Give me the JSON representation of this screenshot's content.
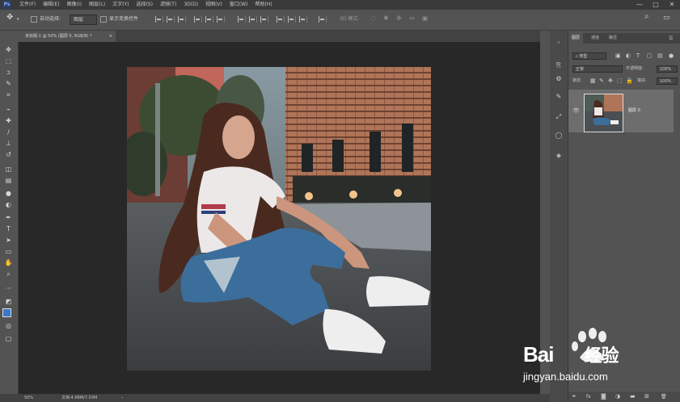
{
  "app": {
    "logo_text": "Ps",
    "menu": [
      "文件(F)",
      "编辑(E)",
      "图像(I)",
      "图层(L)",
      "文字(Y)",
      "选择(S)",
      "滤镜(T)",
      "3D(D)",
      "视图(V)",
      "窗口(W)",
      "帮助(H)"
    ],
    "window_controls": {
      "minimize": "—",
      "maximize": "□",
      "close": "✕"
    }
  },
  "options_bar": {
    "tool_icon": "move-icon",
    "auto_select_label": "自动选择:",
    "auto_select_value": "图层",
    "transform_controls_label": "显示变换控件",
    "mode_3d_label": "3D 模式:",
    "search_icon": "search-icon",
    "workspace_icon": "workspace-icon"
  },
  "document": {
    "tab_title": "未标题-1 @ 50% (图层 0, RGB/8) *",
    "tab_close": "×"
  },
  "status_bar": {
    "zoom": "50%",
    "doc_info": "文档:4.68M/7.03M",
    "arrow": "›"
  },
  "tools": [
    {
      "name": "move-tool",
      "glyph": "✥"
    },
    {
      "name": "marquee-tool",
      "glyph": "⬚"
    },
    {
      "name": "lasso-tool",
      "glyph": "ↄ"
    },
    {
      "name": "quick-select-tool",
      "glyph": "✎"
    },
    {
      "name": "crop-tool",
      "glyph": "⌗"
    },
    {
      "name": "eyedropper-tool",
      "glyph": "⌁"
    },
    {
      "name": "healing-brush-tool",
      "glyph": "✚"
    },
    {
      "name": "brush-tool",
      "glyph": "∕"
    },
    {
      "name": "clone-stamp-tool",
      "glyph": "⊥"
    },
    {
      "name": "history-brush-tool",
      "glyph": "↺"
    },
    {
      "name": "eraser-tool",
      "glyph": "◫"
    },
    {
      "name": "gradient-tool",
      "glyph": "▤"
    },
    {
      "name": "blur-tool",
      "glyph": "●"
    },
    {
      "name": "dodge-tool",
      "glyph": "◐"
    },
    {
      "name": "pen-tool",
      "glyph": "✒"
    },
    {
      "name": "type-tool",
      "glyph": "T"
    },
    {
      "name": "path-select-tool",
      "glyph": "➤"
    },
    {
      "name": "shape-tool",
      "glyph": "▭"
    },
    {
      "name": "hand-tool",
      "glyph": "✋"
    },
    {
      "name": "zoom-tool",
      "glyph": "⌕"
    },
    {
      "name": "more-tools",
      "glyph": "···"
    },
    {
      "name": "default-colors",
      "glyph": "◩"
    },
    {
      "name": "quick-mask",
      "glyph": "◎"
    },
    {
      "name": "screen-mode",
      "glyph": "▢"
    }
  ],
  "colors": {
    "foreground": "#3a78c8",
    "background": "#ffffff"
  },
  "panel_strip": [
    "history-icon",
    "adjust-icon",
    "brush-settings-icon",
    "paths-icon",
    "libraries-icon",
    "3d-icon"
  ],
  "layers_panel": {
    "tabs": [
      "图层",
      "通道",
      "路径"
    ],
    "menu_icon": "☰",
    "filter_kind": "类型",
    "blend_mode": "正常",
    "opacity_label": "不透明度:",
    "opacity_value": "100%",
    "lock_label": "锁定:",
    "fill_label": "填充:",
    "fill_value": "100%",
    "layers": [
      {
        "name": "图层 0",
        "visible": true,
        "selected": true
      }
    ],
    "footer_icons": [
      "link-icon",
      "fx-icon",
      "mask-icon",
      "adjustment-icon",
      "group-icon",
      "new-layer-icon",
      "trash-icon"
    ],
    "footer_glyphs": [
      "⚭",
      "fx",
      "◙",
      "◑",
      "▬",
      "⊞",
      "🗑"
    ]
  },
  "watermark": {
    "brand": "Bai",
    "brand_tail": "经验",
    "url": "jingyan.baidu.com"
  }
}
